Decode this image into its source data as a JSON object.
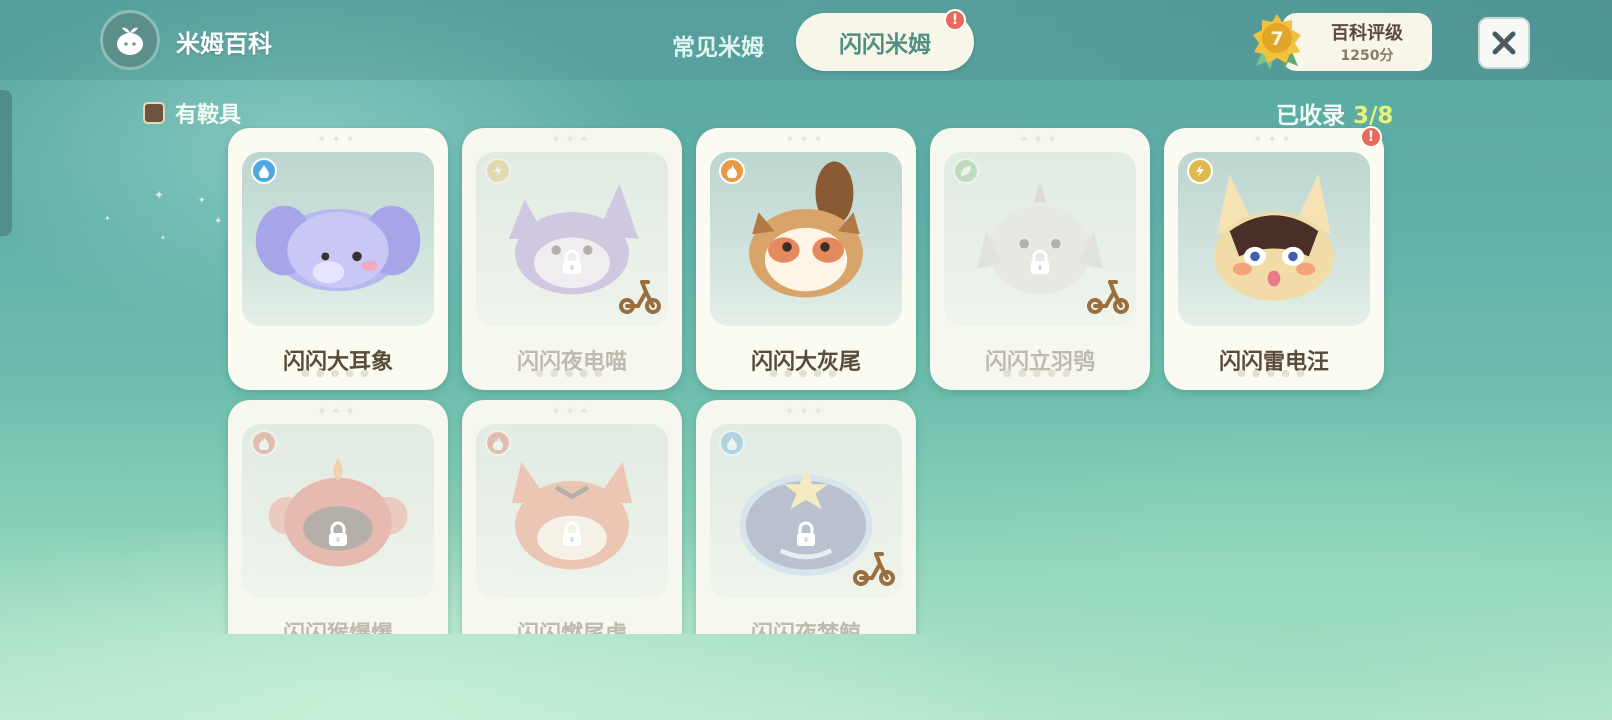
{
  "header": {
    "app_title": "米姆百科",
    "logo_icon": "sprout-icon",
    "tabs": [
      {
        "label": "常见米姆",
        "active": false
      },
      {
        "label": "闪闪米姆",
        "active": true,
        "badge": "!"
      }
    ],
    "rank": {
      "level": "7",
      "title": "百科评级",
      "score": "1250分"
    },
    "close_icon": "close-icon"
  },
  "filter": {
    "label": "有鞍具",
    "checked": false
  },
  "collection": {
    "label": "已收录",
    "count": "3/8"
  },
  "cards": [
    {
      "name": "闪闪大耳象",
      "element": "water",
      "element_color": "#4fa8e0",
      "locked": false,
      "ride": false,
      "badge": false,
      "creature": "elephant",
      "color": "#b9b8f0"
    },
    {
      "name": "闪闪夜电喵",
      "element": "electric",
      "element_color": "#e0b94c",
      "locked": true,
      "ride": true,
      "badge": false,
      "creature": "cat",
      "color": "#8a6fc7"
    },
    {
      "name": "闪闪大灰尾",
      "element": "fire",
      "element_color": "#e69a45",
      "locked": false,
      "ride": false,
      "badge": false,
      "creature": "raccoon",
      "color": "#d9a46a"
    },
    {
      "name": "闪闪立羽鸮",
      "element": "grass",
      "element_color": "#7fc47a",
      "locked": true,
      "ride": true,
      "badge": false,
      "creature": "owl",
      "color": "#cfcfcf"
    },
    {
      "name": "闪闪雷电汪",
      "element": "electric",
      "element_color": "#e0b94c",
      "locked": false,
      "ride": false,
      "badge": true,
      "creature": "dog",
      "color": "#f1dca8"
    },
    {
      "name": "闪闪猴爆爆",
      "element": "fire",
      "element_color": "#e2674f",
      "locked": true,
      "ride": false,
      "badge": false,
      "creature": "monkey",
      "color": "#c94a3a"
    },
    {
      "name": "闪闪燃尾虎",
      "element": "fire",
      "element_color": "#e2674f",
      "locked": true,
      "ride": false,
      "badge": false,
      "creature": "tiger",
      "color": "#d96d4a"
    },
    {
      "name": "闪闪夜梦鲸",
      "element": "water",
      "element_color": "#4fa8e0",
      "locked": true,
      "ride": true,
      "badge": false,
      "creature": "whale",
      "color": "#4a5f94"
    }
  ]
}
